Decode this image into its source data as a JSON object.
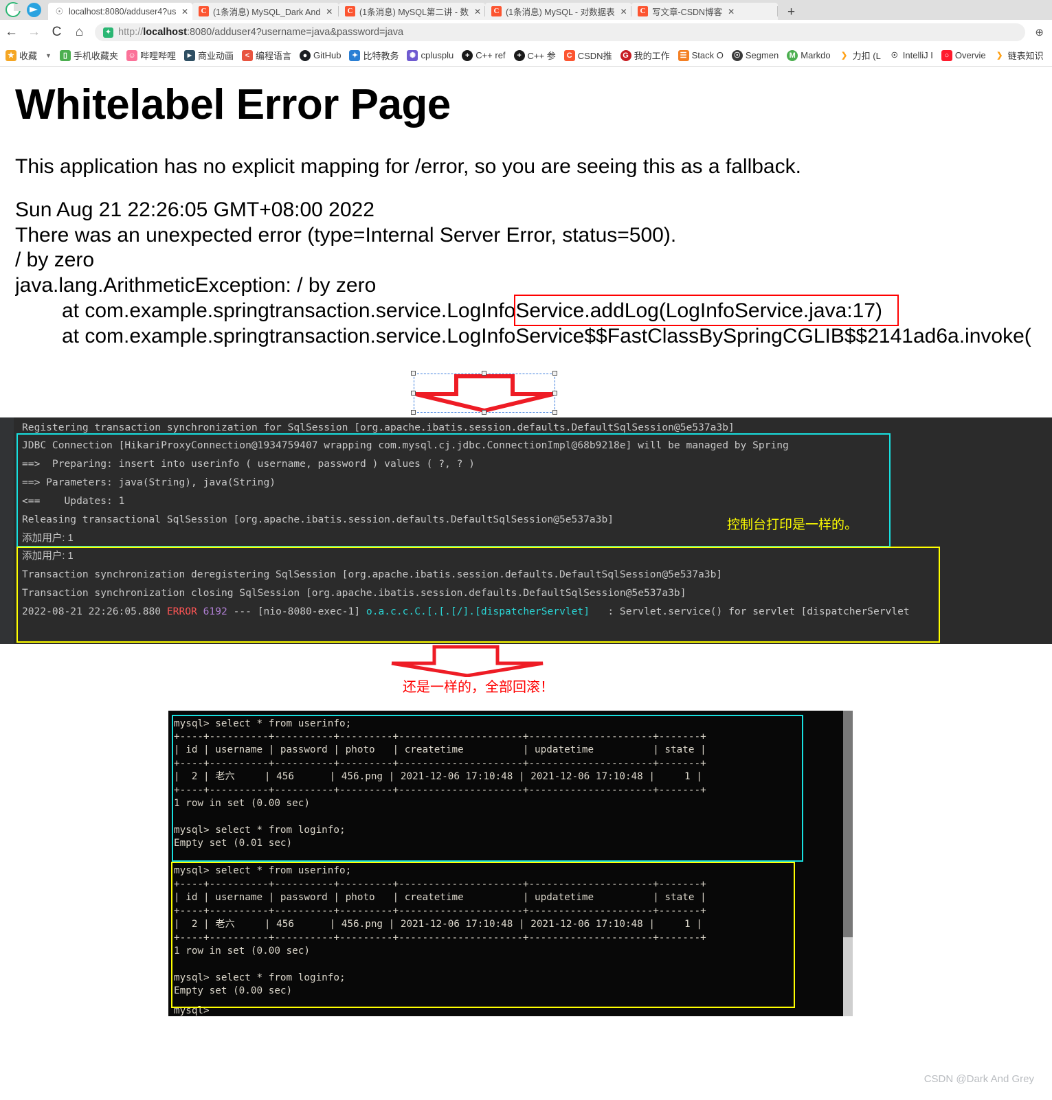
{
  "browser": {
    "tabs": [
      {
        "favicon": "globe-icon",
        "title": "localhost:8080/adduser4?us",
        "active": true
      },
      {
        "favicon": "csdn-icon",
        "title": "(1条消息) MySQL_Dark And",
        "active": false
      },
      {
        "favicon": "csdn-icon",
        "title": "(1条消息) MySQL第二讲 - 数",
        "active": false
      },
      {
        "favicon": "csdn-icon",
        "title": "(1条消息) MySQL - 对数据表",
        "active": false
      },
      {
        "favicon": "csdn-icon",
        "title": "写文章-CSDN博客",
        "active": false
      }
    ],
    "tab_close_label": "✕",
    "new_tab_label": "+",
    "nav": {
      "back": "←",
      "forward": "→",
      "reload": "C",
      "home": "⌂"
    },
    "address": {
      "scheme": "http://",
      "host": "localhost",
      "rest": ":8080/adduser4?username=java&password=java",
      "lock_glyph": "✦",
      "zoom_glyph": "⊕"
    },
    "bookmarks": [
      {
        "label": "收藏",
        "icon": "star-icon",
        "color": "#f5a623"
      },
      {
        "label": "手机收藏夹",
        "icon": "phone-icon",
        "color": "#4caf50"
      },
      {
        "label": "哔哩哔哩",
        "icon": "bilibili-icon",
        "color": "#fb7299"
      },
      {
        "label": "商业动画",
        "icon": "video-icon",
        "color": "#2f4f63"
      },
      {
        "label": "编程语言",
        "icon": "code-icon",
        "color": "#e8543f"
      },
      {
        "label": "GitHub",
        "icon": "github-icon",
        "color": "#1b1f23"
      },
      {
        "label": "比特教务",
        "icon": "bit-icon",
        "color": "#2a7fd4"
      },
      {
        "label": "cplusplu",
        "icon": "cpp-icon",
        "color": "#6f5bd0"
      },
      {
        "label": "C++ ref",
        "icon": "cppref-icon",
        "color": "#1a1a1a"
      },
      {
        "label": "C++ 参",
        "icon": "cppref-icon",
        "color": "#1a1a1a"
      },
      {
        "label": "CSDN推",
        "icon": "csdn-icon",
        "color": "#fc5531"
      },
      {
        "label": "我的工作",
        "icon": "gitee-icon",
        "color": "#c71d23"
      },
      {
        "label": "Stack O",
        "icon": "stackoverflow-icon",
        "color": "#f48024"
      },
      {
        "label": "Segmen",
        "icon": "segmentfault-icon",
        "color": "#3a3a3a"
      },
      {
        "label": "Markdo",
        "icon": "markdown-icon",
        "color": "#4caf50"
      },
      {
        "label": "力扣 (L",
        "icon": "leetcode-icon",
        "color": "#ffa116"
      },
      {
        "label": "IntelliJ I",
        "icon": "intellij-icon",
        "color": "#3a3a3a"
      },
      {
        "label": "Overvie",
        "icon": "opera-icon",
        "color": "#ff1b2d"
      },
      {
        "label": "链表知识",
        "icon": "leetcode-icon",
        "color": "#ffa116"
      }
    ]
  },
  "error_page": {
    "heading": "Whitelabel Error Page",
    "intro": "This application has no explicit mapping for /error, so you are seeing this as a fallback.",
    "timestamp": "Sun Aug 21 22:26:05 GMT+08:00 2022",
    "message": "There was an unexpected error (type=Internal Server Error, status=500).",
    "detail": "/ by zero",
    "exception": "java.lang.ArithmeticException: / by zero",
    "stack_line_1": "at com.example.springtransaction.service.LogInfoService.addLog(LogInfoService.java:17)",
    "stack_line_2": "at com.example.springtransaction.service.LogInfoService$$FastClassBySpringCGLIB$$2141ad6a.invoke("
  },
  "annotations": {
    "red_box_highlight_color": "#ff0000",
    "cyan_box_color": "#18e0e0",
    "yellow_box_color": "#ffff00",
    "console_note": "控制台打印是一样的。",
    "arrow_caption": "还是一样的，全部回滚！",
    "arrow_color": "#ff0000",
    "selection_color": "#3b7ddd"
  },
  "console": {
    "lines": [
      "Registering transaction synchronization for SqlSession [org.apache.ibatis.session.defaults.DefaultSqlSession@5e537a3b]",
      "JDBC Connection [HikariProxyConnection@1934759407 wrapping com.mysql.cj.jdbc.ConnectionImpl@68b9218e] will be managed by Spring",
      "==>  Preparing: insert into userinfo ( username, password ) values ( ?, ? )",
      "==> Parameters: java(String), java(String)",
      "<==    Updates: 1",
      "Releasing transactional SqlSession [org.apache.ibatis.session.defaults.DefaultSqlSession@5e537a3b]",
      "添加用户: 1",
      "添加用户: 1",
      "Transaction synchronization deregistering SqlSession [org.apache.ibatis.session.defaults.DefaultSqlSession@5e537a3b]",
      "Transaction synchronization closing SqlSession [org.apache.ibatis.session.defaults.DefaultSqlSession@5e537a3b]"
    ],
    "error_line": {
      "timestamp": "2022-08-21 22:26:05.880",
      "level": "ERROR",
      "pid": "6192",
      "dashes": "---",
      "thread": "[nio-8080-exec-1]",
      "logger": "o.a.c.c.C.[.[.[/].[dispatcherServlet]",
      "message": ": Servlet.service() for servlet [dispatcherServlet"
    }
  },
  "mysql": {
    "blocks": [
      {
        "prompt_1": "mysql> select * from userinfo;",
        "rule": "+----+----------+----------+---------+---------------------+---------------------+-------+",
        "header": "| id | username | password | photo   | createtime          | updatetime          | state |",
        "row": "|  2 | 老六     | 456      | 456.png | 2021-12-06 17:10:48 | 2021-12-06 17:10:48 |     1 |",
        "result_1": "1 row in set (0.00 sec)",
        "prompt_2": "mysql> select * from loginfo;",
        "result_2": "Empty set (0.01 sec)"
      },
      {
        "prompt_1": "mysql> select * from userinfo;",
        "rule": "+----+----------+----------+---------+---------------------+---------------------+-------+",
        "header": "| id | username | password | photo   | createtime          | updatetime          | state |",
        "row": "|  2 | 老六     | 456      | 456.png | 2021-12-06 17:10:48 | 2021-12-06 17:10:48 |     1 |",
        "result_1": "1 row in set (0.00 sec)",
        "prompt_2": "mysql> select * from loginfo;",
        "result_2": "Empty set (0.00 sec)"
      }
    ],
    "trailing_prompt": "mysql>"
  },
  "watermark": "CSDN @Dark And Grey"
}
